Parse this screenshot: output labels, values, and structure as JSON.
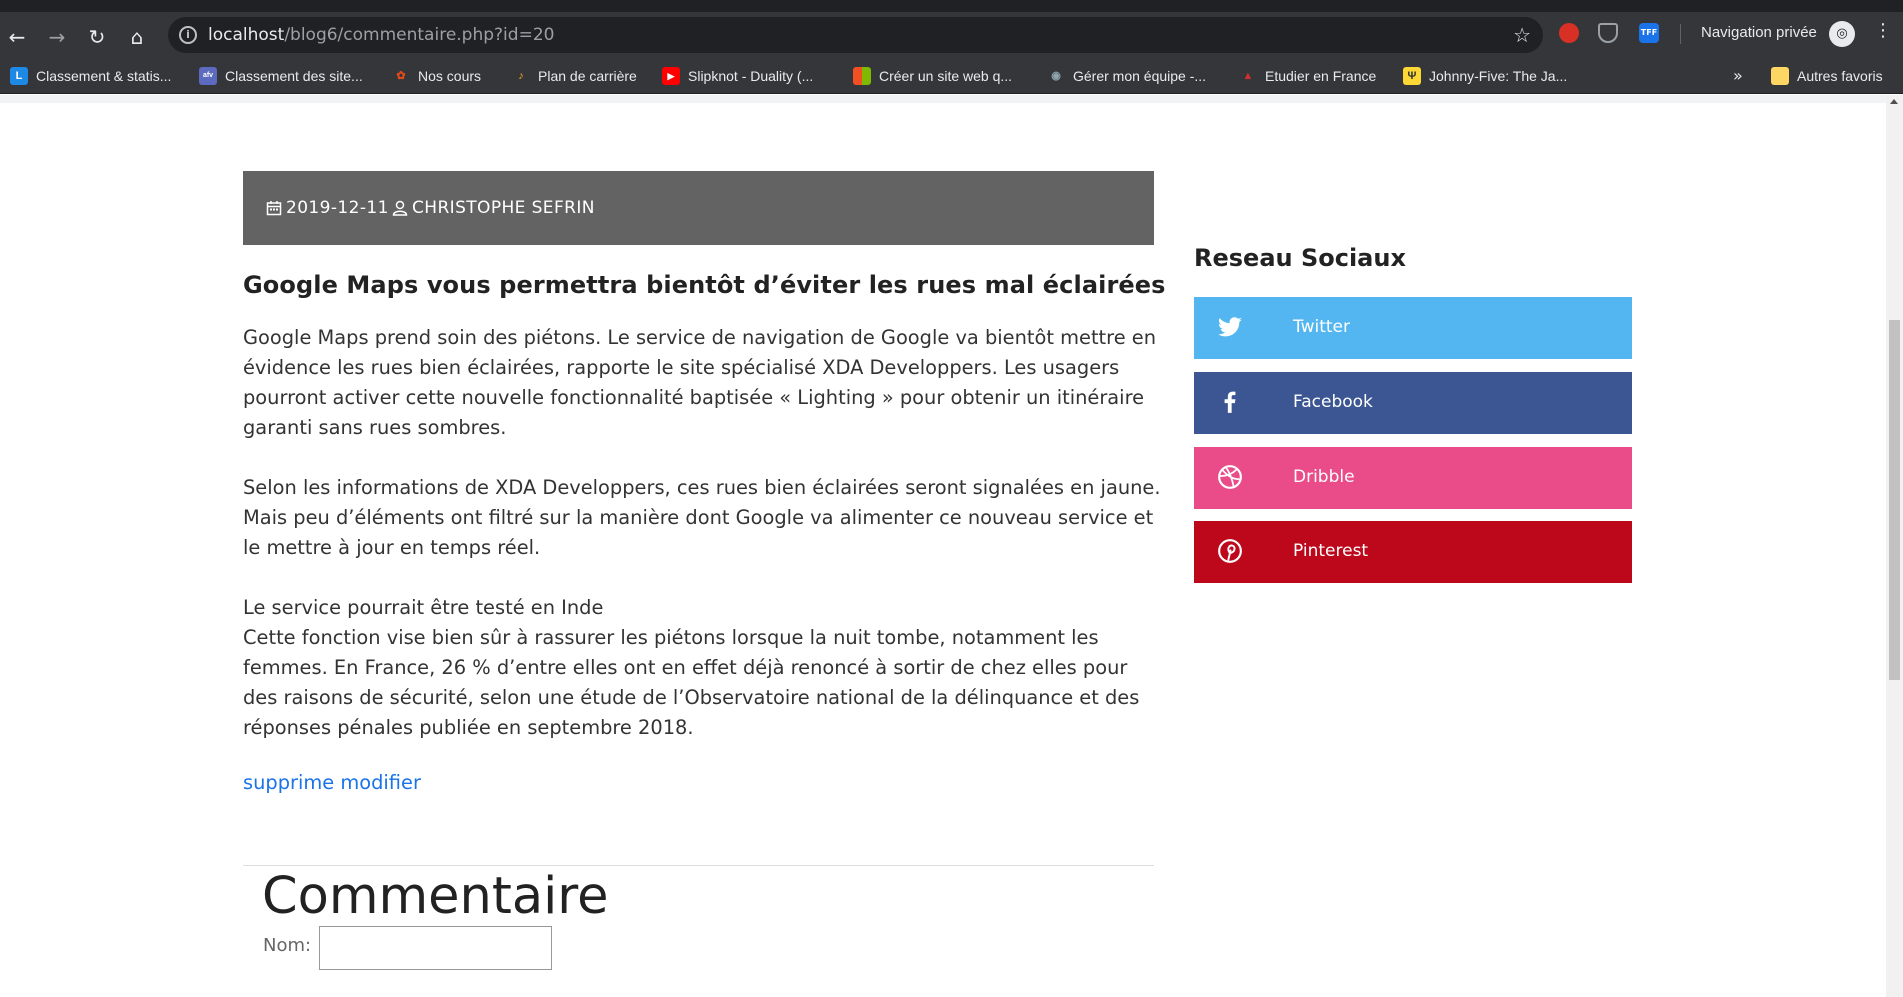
{
  "browser": {
    "url_host": "localhost",
    "url_path": "/blog6/commentaire.php?id=20",
    "incognito_label": "Navigation privée",
    "extension_tff": "TFF",
    "bookmarks": [
      {
        "label": "Classement & statis...",
        "color": "#1e88e5",
        "glyph": "L"
      },
      {
        "label": "Classement des site...",
        "color": "#5c6bc0",
        "glyph": "afv"
      },
      {
        "label": "Nos cours",
        "color": "#e64a19",
        "glyph": "✿"
      },
      {
        "label": "Plan de carrière",
        "color": "#f9a825",
        "glyph": "♪"
      },
      {
        "label": "Slipknot - Duality (...",
        "color": "#ff0000",
        "glyph": "▶"
      },
      {
        "label": "Créer un site web q...",
        "color": "#4caf50",
        "glyph": "■"
      },
      {
        "label": "Gérer mon équipe -...",
        "color": "#90a4ae",
        "glyph": "◉"
      },
      {
        "label": "Etudier en France",
        "color": "#d32f2f",
        "glyph": "▲"
      },
      {
        "label": "Johnny-Five: The Ja...",
        "color": "#fdd835",
        "glyph": "Ψ"
      }
    ],
    "more_bookmarks": "»",
    "other_bookmarks": "Autres favoris"
  },
  "post": {
    "date": "2019-12-11",
    "author": "CHRISTOPHE SEFRIN",
    "title": "Google Maps vous permettra bientôt d’éviter les rues mal éclairées",
    "paragraph1": "Google Maps prend soin des piétons. Le service de navigation de Google va bientôt mettre en évidence les rues bien éclairées, rapporte le site spécialisé XDA Developpers. Les usagers pourront activer cette nouvelle fonctionnalité baptisée « Lighting » pour obtenir un itinéraire garanti sans rues sombres.",
    "paragraph2": "Selon les informations de XDA Developpers, ces rues bien éclairées seront signalées en jaune. Mais peu d’éléments ont filtré sur la manière dont Google va alimenter ce nouveau service et le mettre à jour en temps réel.",
    "paragraph3_line1": "Le service pourrait être testé en Inde",
    "paragraph3_line2": "Cette fonction vise bien sûr à rassurer les piétons lorsque la nuit tombe, notamment les femmes. En France, 26 % d’entre elles ont en effet déjà renoncé à sortir de chez elles pour des raisons de sécurité, selon une étude de l’Observatoire national de la délinquance et des réponses pénales publiée en septembre 2018.",
    "delete_link": "supprime",
    "edit_link": "modifier"
  },
  "comments": {
    "heading": "Commentaire",
    "name_label": "Nom:",
    "name_value": ""
  },
  "sidebar": {
    "title": "Reseau Sociaux",
    "socials": [
      {
        "label": "Twitter",
        "icon": "twitter-icon",
        "color": "#54b6f0"
      },
      {
        "label": "Facebook",
        "icon": "facebook-icon",
        "color": "#3b5693"
      },
      {
        "label": "Dribble",
        "icon": "dribbble-icon",
        "color": "#e94c89"
      },
      {
        "label": "Pinterest",
        "icon": "pinterest-icon",
        "color": "#bd081c"
      }
    ]
  }
}
